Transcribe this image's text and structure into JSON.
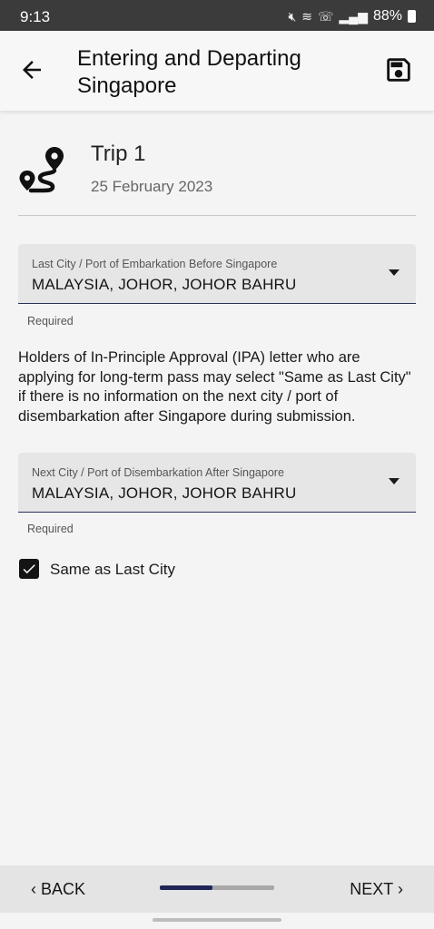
{
  "status_bar": {
    "time": "9:13",
    "battery": "88%",
    "icons": [
      "mute-icon",
      "wifi-icon",
      "call-icon",
      "signal-icon",
      "battery-icon"
    ]
  },
  "app_bar": {
    "title": "Entering and Departing Singapore"
  },
  "trip": {
    "title": "Trip 1",
    "date": "25 February 2023"
  },
  "last_city": {
    "label": "Last City / Port of Embarkation Before Singapore",
    "value": "MALAYSIA, JOHOR, JOHOR BAHRU",
    "helper": "Required"
  },
  "info_text": "Holders of In-Principle Approval (IPA) letter who are applying for long-term pass may select \"Same as Last City\" if there is no information on the next city / port of disembarkation after Singapore during submission.",
  "next_city": {
    "label": "Next City / Port of Disembarkation After Singapore",
    "value": "MALAYSIA, JOHOR, JOHOR BAHRU",
    "helper": "Required"
  },
  "same_as_last": {
    "label": "Same as Last City",
    "checked": true
  },
  "bottom_nav": {
    "back_label": "BACK",
    "next_label": "NEXT",
    "progress": 0.46
  },
  "colors": {
    "accent": "#1f2657",
    "field_bg": "#e6e6e6",
    "background": "#f4f4f4"
  }
}
